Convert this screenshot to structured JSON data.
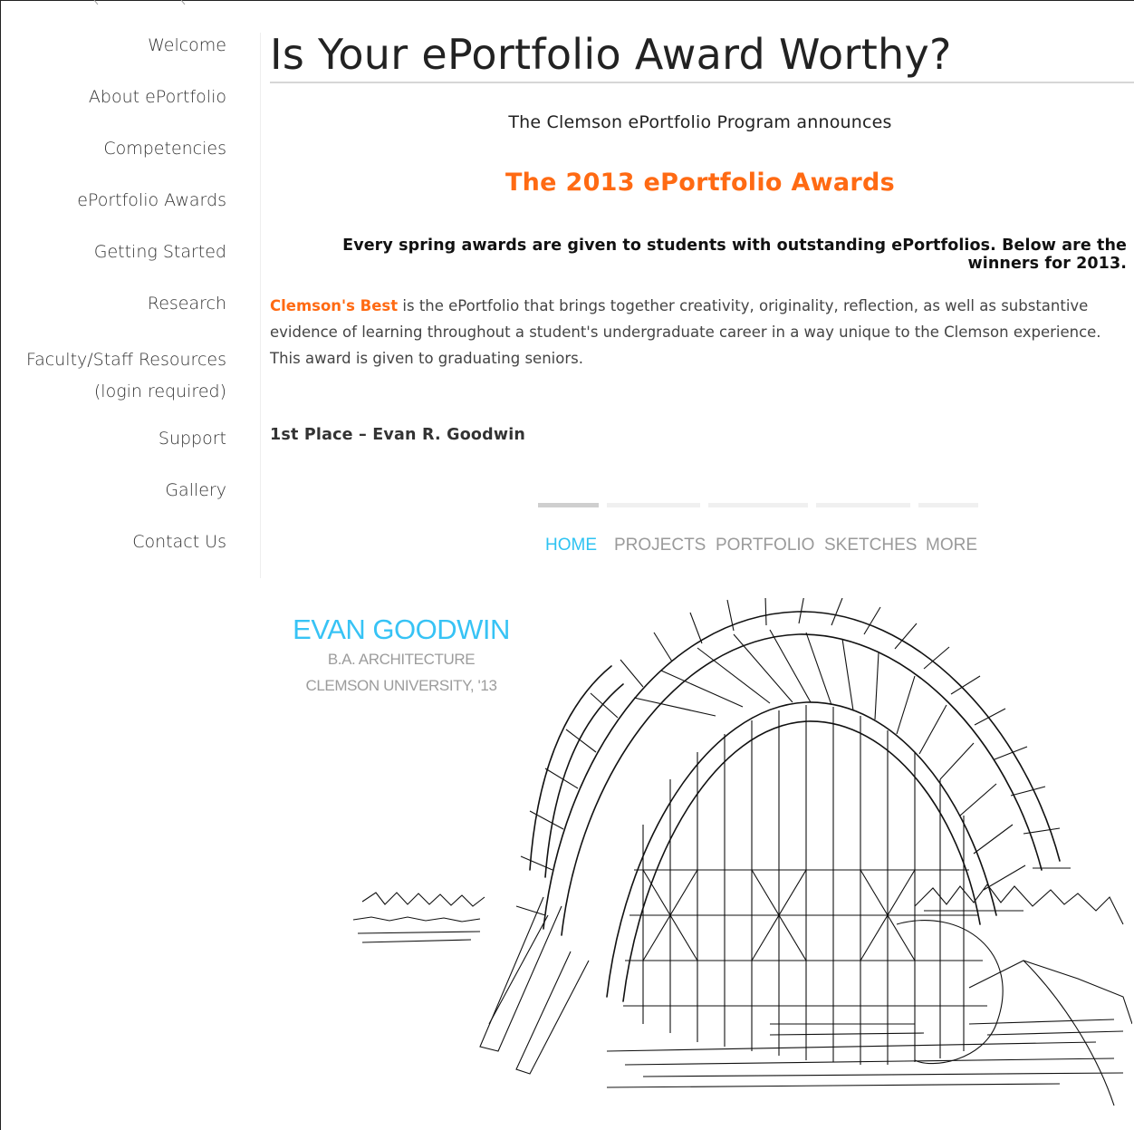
{
  "nav": {
    "items": [
      {
        "label": "Welcome"
      },
      {
        "label": "About ePortfolio"
      },
      {
        "label": "Competencies"
      },
      {
        "label": "ePortfolio Awards"
      },
      {
        "label": "Getting Started"
      },
      {
        "label": "Research"
      },
      {
        "label": "Faculty/Staff Resources",
        "label2": "(login required)"
      },
      {
        "label": "Support"
      },
      {
        "label": "Gallery"
      },
      {
        "label": "Contact Us"
      }
    ]
  },
  "main": {
    "title": "Is Your ePortfolio Award Worthy?",
    "announces": "The Clemson ePortfolio Program announces",
    "awards_title": "The 2013 ePortfolio Awards",
    "lead": "Every spring awards are given to students with outstanding ePortfolios. Below are the winners for 2013.",
    "award_name": "Clemson's Best",
    "award_description": " is the ePortfolio that brings together creativity, originality, reflection, as well as substantive evidence of learning throughout a student's undergraduate career in a way unique to the Clemson experience. This award is given to graduating seniors.",
    "place": "1st Place – Evan R. Goodwin"
  },
  "portfolio_preview": {
    "nav": [
      "HOME",
      "PROJECTS",
      "PORTFOLIO",
      "SKETCHES",
      "MORE"
    ],
    "active_nav": "HOME",
    "name": "EVAN GOODWIN",
    "degree": "B.A. ARCHITECTURE",
    "school": "CLEMSON UNIVERSITY, '13",
    "sketch_icon": "architecture-sketch"
  },
  "colors": {
    "accent": "#ff6a13",
    "link_blue": "#2ec3f2",
    "text": "#222222"
  }
}
